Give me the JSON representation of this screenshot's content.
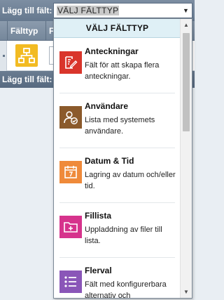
{
  "toolbar": {
    "label": "Lägg till fält:",
    "select_value": "VÄLJ FÄLTTYP"
  },
  "table": {
    "columns": [
      "Fälttyp",
      "F"
    ]
  },
  "subbar": {
    "label": "Lägg till fält:"
  },
  "dropdown": {
    "header": "VÄLJ FÄLTTYP",
    "items": [
      {
        "title": "Anteckningar",
        "description": "Fält för att skapa flera anteckningar.",
        "color": "#d9352b",
        "icon": "notes-icon"
      },
      {
        "title": "Användare",
        "description": "Lista med systemets användare.",
        "color": "#8b5a2b",
        "icon": "user-check-icon"
      },
      {
        "title": "Datum & Tid",
        "description": "Lagring av datum och/eller tid.",
        "color": "#ef8a3a",
        "icon": "calendar-icon"
      },
      {
        "title": "Fillista",
        "description": "Uppladdning av filer till lista.",
        "color": "#d6338c",
        "icon": "folder-add-icon"
      },
      {
        "title": "Flerval",
        "description": "Fält med konfigurerbara alternativ och",
        "color": "#8a56b8",
        "icon": "list-icon"
      }
    ]
  },
  "colors": {
    "header_bar": "#6f8196",
    "dropdown_header": "#dff0f6",
    "row_icon": "#f2bb22"
  }
}
